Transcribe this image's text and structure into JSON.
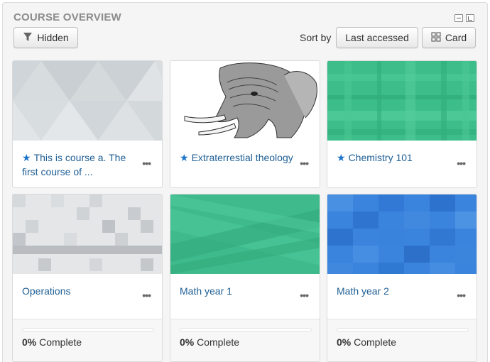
{
  "block": {
    "title": "COURSE OVERVIEW",
    "controls": [
      "minimize-icon",
      "dock-icon"
    ]
  },
  "toolbar": {
    "filter_label": "Hidden",
    "sort_prefix": "Sort by",
    "sort_value": "Last accessed",
    "view_label": "Card"
  },
  "courses": [
    {
      "title": "This is course a. The first course of ...",
      "starred": true,
      "image": "grey-triangles"
    },
    {
      "title": "Extraterrestial theology",
      "starred": true,
      "image": "elephant-engraving"
    },
    {
      "title": "Chemistry 101",
      "starred": true,
      "image": "green-plaid"
    },
    {
      "title": "Operations",
      "starred": false,
      "image": "grey-squares",
      "progress_percent": 0,
      "progress_text": "Complete",
      "progress_value_label": "0%"
    },
    {
      "title": "Math year 1",
      "starred": false,
      "image": "green-diagonals",
      "progress_percent": 0,
      "progress_text": "Complete",
      "progress_value_label": "0%"
    },
    {
      "title": "Math year 2",
      "starred": false,
      "image": "blue-squares",
      "progress_percent": 0,
      "progress_text": "Complete",
      "progress_value_label": "0%"
    }
  ],
  "colors": {
    "link": "#1f5f95",
    "star": "#1a73c9",
    "title_grey": "#8c8c8c"
  }
}
